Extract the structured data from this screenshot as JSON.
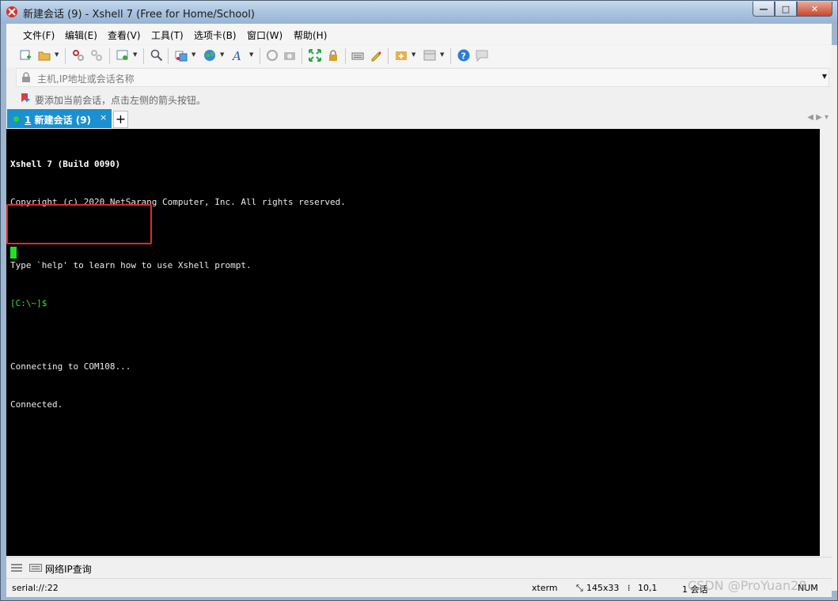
{
  "window": {
    "title": "新建会话 (9) - Xshell 7 (Free for Home/School)",
    "controls": {
      "minimize": "—",
      "maximize": "□",
      "close": "✕"
    }
  },
  "menu": {
    "items": [
      "文件(F)",
      "编辑(E)",
      "查看(V)",
      "工具(T)",
      "选项卡(B)",
      "窗口(W)",
      "帮助(H)"
    ]
  },
  "toolbar": {
    "icons": [
      "new-session-icon",
      "open-folder-icon",
      "connect-icon",
      "disconnect-icon",
      "properties-icon",
      "find-icon",
      "transfer-icon",
      "globe-icon",
      "font-icon",
      "script-icon",
      "screenshot-icon",
      "fullscreen-icon",
      "lock-icon",
      "keyboard-icon",
      "highlight-icon",
      "add-icon",
      "layout-icon",
      "help-icon",
      "chat-icon"
    ]
  },
  "address": {
    "placeholder": "主机,IP地址或会话名称"
  },
  "hint": {
    "text": "要添加当前会话，点击左侧的箭头按钮。"
  },
  "tabs": [
    {
      "number": "1",
      "label": " 新建会话 (9)",
      "close": "×",
      "active": true
    }
  ],
  "tab_add": "+",
  "tab_nav": "◀ ▶  ▾",
  "terminal": {
    "lines": [
      "Xshell 7 (Build 0090)",
      "Copyright (c) 2020 NetSarang Computer, Inc. All rights reserved.",
      "",
      "Type `help' to learn how to use Xshell prompt.",
      "[C:\\~]$",
      "",
      "Connecting to COM108...",
      "Connected."
    ]
  },
  "bottom": {
    "tool_label": "网络IP查询"
  },
  "status": {
    "connection": "serial://:22",
    "terminal_type": "xterm",
    "size": "145x33",
    "cursor_pos": "10,1",
    "sessions": "1 会话",
    "num": "NUM"
  },
  "watermark": "CSDN @ProYuan28",
  "colors": {
    "tab_active": "#1a90d0",
    "terminal_bg": "#000000",
    "prompt": "#3cdc3c",
    "cursor": "#22e022",
    "highlight_box": "#e02a2a"
  }
}
